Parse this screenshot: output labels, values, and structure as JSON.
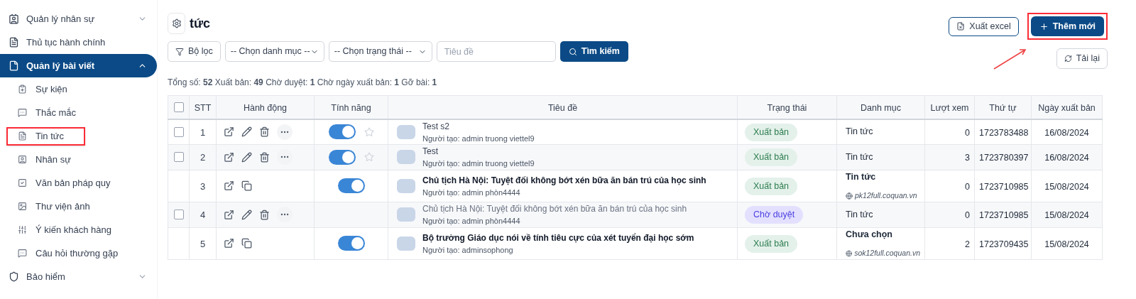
{
  "sidebar": {
    "items": [
      {
        "label": "Quản lý nhân sự",
        "expanded": false,
        "selected": false
      },
      {
        "label": "Thủ tục hành chính",
        "selected": false
      },
      {
        "label": "Quản lý bài viết",
        "expanded": true,
        "selected": true,
        "children": [
          {
            "label": "Sự kiện",
            "selected": false,
            "highlighted": false
          },
          {
            "label": "Thắc mắc",
            "selected": false,
            "highlighted": false
          },
          {
            "label": "Tin tức",
            "selected": false,
            "highlighted": true
          },
          {
            "label": "Nhân sự",
            "selected": false,
            "highlighted": false
          },
          {
            "label": "Văn bản pháp quy",
            "selected": false,
            "highlighted": false
          },
          {
            "label": "Thư viện ảnh",
            "selected": false,
            "highlighted": false
          },
          {
            "label": "Ý kiến khách hàng",
            "selected": false,
            "highlighted": false
          },
          {
            "label": "Câu hỏi thường gặp",
            "selected": false,
            "highlighted": false
          }
        ]
      },
      {
        "label": "Bảo hiểm",
        "expanded": false,
        "selected": false
      }
    ]
  },
  "page": {
    "title": "tức",
    "export_button": "Xuất excel",
    "add_button": {
      "label": "Thêm mới",
      "highlighted": true
    },
    "reload_button": "Tải lại"
  },
  "filters": {
    "filter_button": "Bộ lọc",
    "category_select": "-- Chọn danh mục --",
    "status_select": "-- Chọn trạng thái --",
    "title_placeholder": "Tiêu đề",
    "search_button": "Tìm kiếm"
  },
  "summary": "Tổng số: **52** Xuất bản: **49** Chờ duyệt: **1** Chờ ngày xuất bản: **1** Gỡ bài: **1**",
  "table": {
    "select_all_checked": false,
    "columns": [
      "STT",
      "Hành động",
      "Tính năng",
      "Tiêu đề",
      "Trạng thái",
      "Danh mục",
      "Lượt xem",
      "Thứ tự",
      "Ngày xuất bản"
    ],
    "rows": [
      {
        "kind": "own",
        "checked": false,
        "stt": "1",
        "toggle_on": true,
        "starred": false,
        "title": "Test s2",
        "title_bold": false,
        "title_muted": false,
        "author": "Người tạo: admin truong viettel9",
        "status": "Xuất bản",
        "pending": false,
        "category": "Tin tức",
        "views": "0",
        "order": "1723783488",
        "date": "16/08/2024"
      },
      {
        "kind": "own",
        "checked": false,
        "stt": "2",
        "toggle_on": true,
        "starred": false,
        "title": "Test",
        "title_bold": false,
        "title_muted": false,
        "author": "Người tạo: admin truong viettel9",
        "status": "Xuất bản",
        "pending": false,
        "category": "Tin tức",
        "views": "3",
        "order": "1723780397",
        "date": "16/08/2024"
      },
      {
        "kind": "shared",
        "stt": "3",
        "toggle_on": true,
        "title": "Chủ tịch Hà Nội: Tuyệt đối không bớt xén bữa ăn bán trú của học sinh",
        "title_bold": true,
        "title_muted": false,
        "author": "Người tạo: admin phòn4444",
        "status": "Xuất bản",
        "pending": false,
        "category": "Tin tức",
        "domain": "pk12full.coquan.vn",
        "views": "0",
        "order": "1723710985",
        "date": "15/08/2024"
      },
      {
        "kind": "own",
        "checked": false,
        "stt": "4",
        "title": "Chủ tịch Hà Nội: Tuyệt đối không bớt xén bữa ăn bán trú của học sinh",
        "title_bold": false,
        "title_muted": true,
        "author": "Người tạo: admin phòn4444",
        "status": "Chờ duyệt",
        "pending": true,
        "category": "Tin tức",
        "views": "0",
        "order": "1723710985",
        "date": "15/08/2024"
      },
      {
        "kind": "shared",
        "stt": "5",
        "toggle_on": true,
        "title": "Bộ trưởng Giáo dục nói về tính tiêu cực của xét tuyển đại học sớm",
        "title_bold": true,
        "title_muted": false,
        "author": "Người tạo: adminsophong",
        "status": "Xuất bản",
        "pending": false,
        "category": "Chưa chọn",
        "domain": "sok12full.coquan.vn",
        "views": "2",
        "order": "1723709435",
        "date": "15/08/2024"
      }
    ]
  }
}
